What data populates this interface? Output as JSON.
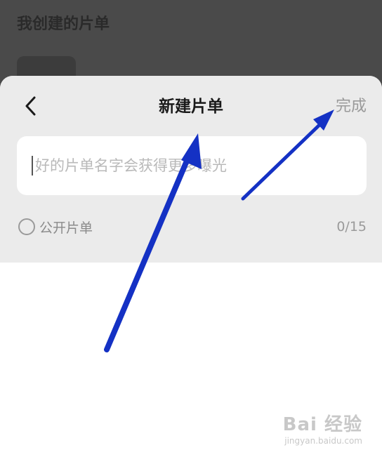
{
  "backdrop": {
    "title": "我创建的片单"
  },
  "sheet": {
    "title": "新建片单",
    "done_label": "完成",
    "name_input": {
      "placeholder": "好的片单名字会获得更多曝光",
      "value": ""
    },
    "public_label": "公开片单",
    "char_counter": "0/15"
  },
  "annotations": {
    "arrow_color": "#1431c4"
  },
  "watermark": {
    "main": "Bai 经验",
    "sub": "jingyan.baidu.com"
  },
  "colors": {
    "backdrop": "#4a4a4a",
    "sheet_header_bg": "#ebebeb",
    "done_text": "#9a9a9a",
    "placeholder_text": "#b9b9b9"
  }
}
